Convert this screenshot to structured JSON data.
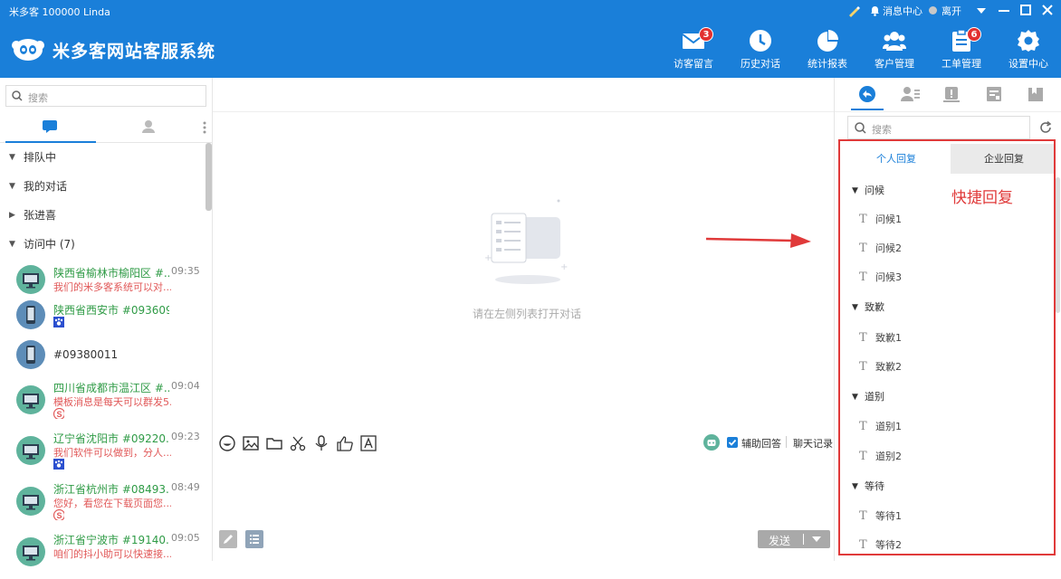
{
  "titlebar": {
    "title": "米多客 100000 Linda",
    "msg_center": "消息中心",
    "status": "离开"
  },
  "header": {
    "brand": "米多客网站客服系统",
    "nav": [
      {
        "label": "访客留言",
        "icon": "envelope-icon",
        "badge": "3"
      },
      {
        "label": "历史对话",
        "icon": "clock-icon",
        "badge": ""
      },
      {
        "label": "统计报表",
        "icon": "pie-chart-icon",
        "badge": ""
      },
      {
        "label": "客户管理",
        "icon": "users-icon",
        "badge": ""
      },
      {
        "label": "工单管理",
        "icon": "clipboard-icon",
        "badge": "6"
      },
      {
        "label": "设置中心",
        "icon": "gear-icon",
        "badge": ""
      }
    ]
  },
  "left": {
    "search_placeholder": "搜索",
    "groups": [
      {
        "label": "排队中",
        "expanded": true
      },
      {
        "label": "我的对话",
        "expanded": true
      },
      {
        "label": "张进喜",
        "expanded": false
      },
      {
        "label": "访问中 (7)",
        "expanded": true
      }
    ],
    "conversations": [
      {
        "name": "陕西省榆林市榆阳区 #...",
        "time": "09:35",
        "msg": "我们的米多客系统可以对...",
        "device": "pc",
        "source": ""
      },
      {
        "name": "陕西省西安市 #093609...",
        "time": "",
        "msg": "",
        "device": "mobile",
        "source": "paw-icon"
      },
      {
        "name": "#09380011",
        "time": "",
        "msg": "",
        "device": "mobile",
        "source": ""
      },
      {
        "name": "四川省成都市温江区 #...",
        "time": "09:04",
        "msg": "模板消息是每天可以群发5...",
        "device": "pc",
        "source": "weibo-icon"
      },
      {
        "name": "辽宁省沈阳市 #09220...",
        "time": "09:23",
        "msg": "我们软件可以做到，分人...",
        "device": "pc",
        "source": "paw-icon"
      },
      {
        "name": "浙江省杭州市 #08493...",
        "time": "08:49",
        "msg": "您好，看您在下载页面您...",
        "device": "pc",
        "source": "weibo-icon"
      },
      {
        "name": "浙江省宁波市 #19140...",
        "time": "09:05",
        "msg": "咱们的抖小助可以快速接...",
        "device": "pc",
        "source": ""
      }
    ]
  },
  "center": {
    "empty_text": "请在左侧列表打开对话",
    "assist_label": "辅助回答",
    "history_label": "聊天记录",
    "send_label": "发送"
  },
  "right": {
    "search_placeholder": "搜索",
    "tab_personal": "个人回复",
    "tab_company": "企业回复",
    "groups": [
      {
        "label": "问候",
        "items": [
          "问候1",
          "问候2",
          "问候3"
        ]
      },
      {
        "label": "致歉",
        "items": [
          "致歉1",
          "致歉2"
        ]
      },
      {
        "label": "道别",
        "items": [
          "道别1",
          "道别2"
        ]
      },
      {
        "label": "等待",
        "items": [
          "等待1",
          "等待2"
        ]
      }
    ]
  },
  "annotation": {
    "text": "快捷回复",
    "color": "#e03a3a"
  },
  "colors": {
    "primary": "#1a7fd9",
    "visitor_name": "#2f9b46",
    "visitor_msg": "#e15858",
    "highlight_box": "#e03a3a"
  }
}
